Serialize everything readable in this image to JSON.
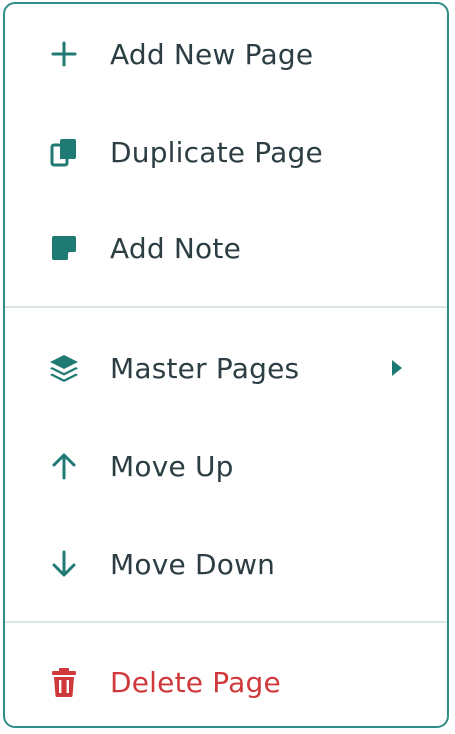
{
  "colors": {
    "accent": "#1f7a74",
    "text": "#2c3e43",
    "danger": "#d0393c",
    "border": "#2f8c86",
    "divider": "#d9e6e5"
  },
  "menu": {
    "items": [
      {
        "label": "Add New Page",
        "icon": "plus-icon"
      },
      {
        "label": "Duplicate Page",
        "icon": "duplicate-icon"
      },
      {
        "label": "Add Note",
        "icon": "note-icon"
      },
      {
        "label": "Master Pages",
        "icon": "layers-icon",
        "submenu_icon": "chevron-right-icon"
      },
      {
        "label": "Move Up",
        "icon": "arrow-up-icon"
      },
      {
        "label": "Move Down",
        "icon": "arrow-down-icon"
      },
      {
        "label": "Delete Page",
        "icon": "trash-icon"
      }
    ]
  }
}
